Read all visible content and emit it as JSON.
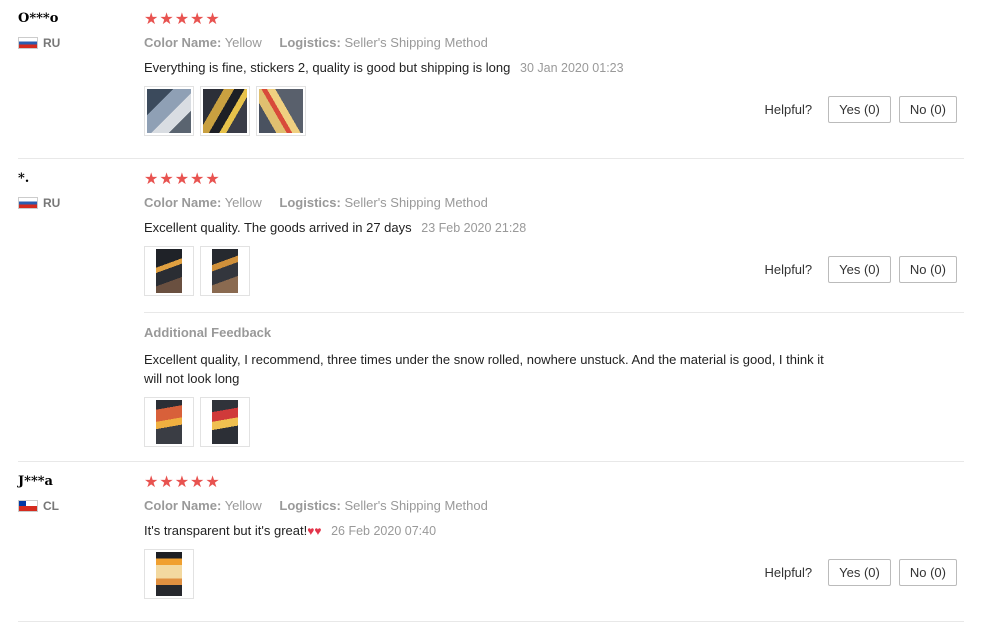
{
  "reviews": [
    {
      "username": "O***o",
      "country": "RU",
      "stars": "★★★★★",
      "color_label": "Color Name:",
      "color_value": "Yellow",
      "logistics_label": "Logistics:",
      "logistics_value": "Seller's Shipping Method",
      "text": "Everything is fine, stickers 2, quality is good but shipping is long",
      "date": "30 Jan 2020 01:23",
      "helpful_label": "Helpful?",
      "yes_label": "Yes (0)",
      "no_label": "No (0)"
    },
    {
      "username": "*.",
      "country": "RU",
      "stars": "★★★★★",
      "color_label": "Color Name:",
      "color_value": "Yellow",
      "logistics_label": "Logistics:",
      "logistics_value": "Seller's Shipping Method",
      "text": "Excellent quality. The goods arrived in 27 days",
      "date": "23 Feb 2020 21:28",
      "helpful_label": "Helpful?",
      "yes_label": "Yes (0)",
      "no_label": "No (0)",
      "additional_title": "Additional Feedback",
      "additional_text": "Excellent quality, I recommend, three times under the snow rolled, nowhere unstuck. And the material is good, I think it will not look long"
    },
    {
      "username": "J***a",
      "country": "CL",
      "stars": "★★★★★",
      "color_label": "Color Name:",
      "color_value": "Yellow",
      "logistics_label": "Logistics:",
      "logistics_value": "Seller's Shipping Method",
      "text": "It's transparent but it's great!",
      "hearts": "♥♥",
      "date": "26 Feb 2020 07:40",
      "helpful_label": "Helpful?",
      "yes_label": "Yes (0)",
      "no_label": "No (0)"
    }
  ],
  "colors": {
    "star": "#e85350",
    "muted": "#999999",
    "divider": "#e8e8e8"
  }
}
